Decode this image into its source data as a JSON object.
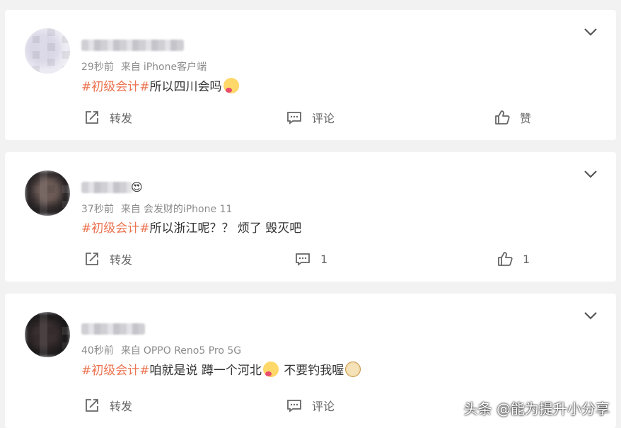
{
  "posts": [
    {
      "time": "29秒前",
      "source_label": "来自",
      "source": "iPhone客户端",
      "tag": "#初级会计#",
      "text": "所以四川会吗",
      "text_after": "",
      "repost_label": "转发",
      "comment_label": "评论",
      "like_label": "赞"
    },
    {
      "time": "37秒前",
      "source_label": "来自",
      "source": "会发财的iPhone 11",
      "tag": "#初级会计#",
      "text": "所以浙江呢？？ 烦了 毁灭吧",
      "text_after": "",
      "repost_label": "转发",
      "comment_count": "1",
      "like_count": "1"
    },
    {
      "time": "40秒前",
      "source_label": "来自",
      "source": "OPPO Reno5 Pro 5G",
      "tag": "#初级会计#",
      "text": "咱就是说 蹲一个河北",
      "text_after": " 不要钓我喔",
      "repost_label": "转发",
      "comment_label": "评论"
    }
  ],
  "watermark": "头条 @能为提升小分享",
  "colors": {
    "tag": "#eb7350",
    "meta": "#8c8c8c",
    "action": "#666666",
    "background": "#f2f2f2"
  },
  "icons": [
    "repost-icon",
    "comment-icon",
    "like-icon",
    "chevron-down-icon",
    "blush-emoji-icon",
    "doge-emoji-icon",
    "love-eyes-badge-icon"
  ]
}
